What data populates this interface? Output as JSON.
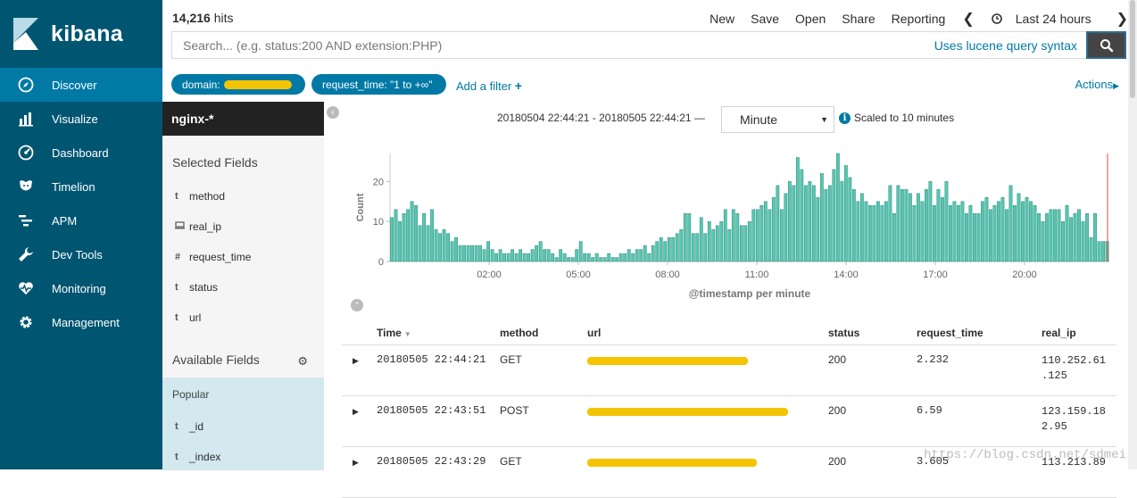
{
  "app": {
    "name": "kibana"
  },
  "nav": {
    "items": [
      {
        "label": "Discover",
        "icon": "compass-icon",
        "active": true
      },
      {
        "label": "Visualize",
        "icon": "bar-chart-icon"
      },
      {
        "label": "Dashboard",
        "icon": "gauge-icon"
      },
      {
        "label": "Timelion",
        "icon": "timelion-icon"
      },
      {
        "label": "APM",
        "icon": "apm-icon"
      },
      {
        "label": "Dev Tools",
        "icon": "wrench-icon"
      },
      {
        "label": "Monitoring",
        "icon": "heartbeat-icon"
      },
      {
        "label": "Management",
        "icon": "gear-icon"
      }
    ]
  },
  "topbar": {
    "hits_count": "14,216",
    "hits_label": "hits",
    "links": [
      "New",
      "Save",
      "Open",
      "Share",
      "Reporting"
    ],
    "time_range": "Last 24 hours",
    "search_placeholder": "Search... (e.g. status:200 AND extension:PHP)",
    "lucene_link": "Uses lucene query syntax"
  },
  "filters": {
    "pills": [
      {
        "key": "domain:",
        "value_redacted": true
      },
      {
        "key": "request_time: \"1 to +∞\""
      }
    ],
    "add_filter": "Add a filter",
    "actions": "Actions"
  },
  "sidebar": {
    "index_pattern": "nginx-*",
    "selected_title": "Selected Fields",
    "selected_fields": [
      {
        "type": "t",
        "name": "method"
      },
      {
        "type": "ip",
        "name": "real_ip"
      },
      {
        "type": "#",
        "name": "request_time"
      },
      {
        "type": "t",
        "name": "status"
      },
      {
        "type": "t",
        "name": "url"
      }
    ],
    "available_title": "Available Fields",
    "popular_label": "Popular",
    "popular_fields": [
      {
        "type": "t",
        "name": "_id"
      },
      {
        "type": "t",
        "name": "_index"
      }
    ]
  },
  "histogram": {
    "range_text": "20180504 22:44:21 - 20180505 22:44:21 —",
    "interval": "Minute",
    "scaled_text": "Scaled to 10 minutes"
  },
  "chart_data": {
    "type": "bar",
    "ylabel": "Count",
    "xlabel": "@timestamp per minute",
    "ylim": [
      0,
      27
    ],
    "yticks": [
      0,
      10,
      20
    ],
    "x_tick_labels": [
      "02:00",
      "05:00",
      "08:00",
      "11:00",
      "14:00",
      "17:00",
      "20:00"
    ],
    "values": [
      11,
      13,
      10,
      12,
      13,
      15,
      14,
      9,
      12,
      9,
      13,
      8,
      7,
      8,
      7,
      5,
      6,
      4,
      4,
      4,
      4,
      4,
      4,
      3,
      5,
      3,
      2,
      3,
      2,
      2,
      3,
      2,
      3,
      2,
      2,
      3,
      4,
      5,
      3,
      3,
      2,
      1,
      3,
      2,
      1,
      1,
      3,
      5,
      2,
      2,
      1,
      2,
      1,
      1,
      2,
      1,
      1,
      2,
      2,
      3,
      2,
      3,
      3,
      4,
      2,
      4,
      5,
      6,
      5,
      6,
      6,
      7,
      8,
      12,
      12,
      7,
      7,
      11,
      7,
      10,
      8,
      9,
      10,
      13,
      8,
      13,
      12,
      9,
      9,
      10,
      13,
      13,
      14,
      15,
      13,
      16,
      19,
      13,
      17,
      20,
      19,
      26,
      23,
      19,
      20,
      19,
      16,
      22,
      18,
      19,
      23,
      27,
      20,
      24,
      21,
      18,
      15,
      17,
      15,
      14,
      14,
      15,
      14,
      15,
      19,
      12,
      19,
      18,
      18,
      17,
      14,
      17,
      15,
      18,
      20,
      14,
      18,
      16,
      20,
      14,
      15,
      14,
      15,
      12,
      14,
      12,
      12,
      15,
      16,
      13,
      14,
      15,
      16,
      13,
      19,
      14,
      17,
      15,
      16,
      15,
      14,
      12,
      10,
      12,
      13,
      13,
      13,
      10,
      14,
      11,
      12,
      13,
      10,
      12,
      6,
      12,
      5,
      5,
      5
    ]
  },
  "table": {
    "columns": [
      "Time",
      "method",
      "url",
      "status",
      "request_time",
      "real_ip"
    ],
    "rows": [
      {
        "time": "20180505 22:44:21",
        "method": "GET",
        "status": "200",
        "request_time": "2.232",
        "real_ip": "110.252.61.125"
      },
      {
        "time": "20180505 22:43:51",
        "method": "POST",
        "status": "200",
        "request_time": "6.59",
        "real_ip": "123.159.182.95"
      },
      {
        "time": "20180505 22:43:29",
        "method": "GET",
        "status": "200",
        "request_time": "3.605",
        "real_ip": "113.213.89"
      }
    ]
  },
  "watermark": "https://blog.csdn.net/sdmei"
}
